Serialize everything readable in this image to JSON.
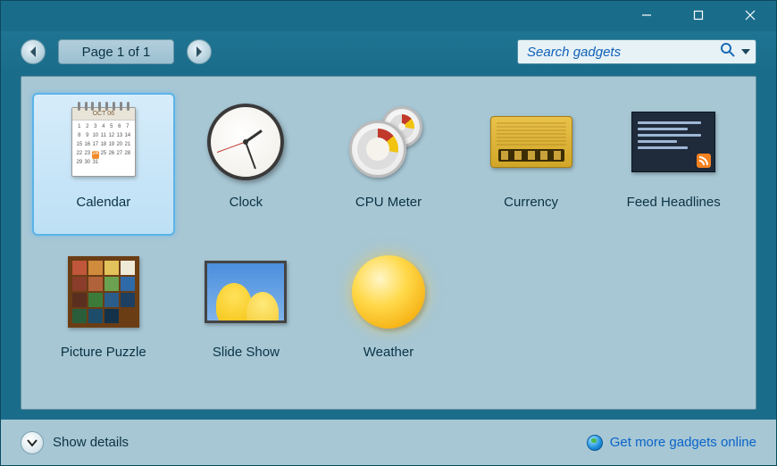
{
  "pager": {
    "label": "Page 1 of 1"
  },
  "search": {
    "placeholder": "Search gadgets"
  },
  "gadgets": [
    {
      "label": "Calendar",
      "selected": true,
      "cal_month": "OCT 06"
    },
    {
      "label": "Clock",
      "selected": false
    },
    {
      "label": "CPU Meter",
      "selected": false
    },
    {
      "label": "Currency",
      "selected": false
    },
    {
      "label": "Feed Headlines",
      "selected": false
    },
    {
      "label": "Picture Puzzle",
      "selected": false
    },
    {
      "label": "Slide Show",
      "selected": false
    },
    {
      "label": "Weather",
      "selected": false
    }
  ],
  "footer": {
    "details": "Show details",
    "more": "Get more gadgets online"
  }
}
